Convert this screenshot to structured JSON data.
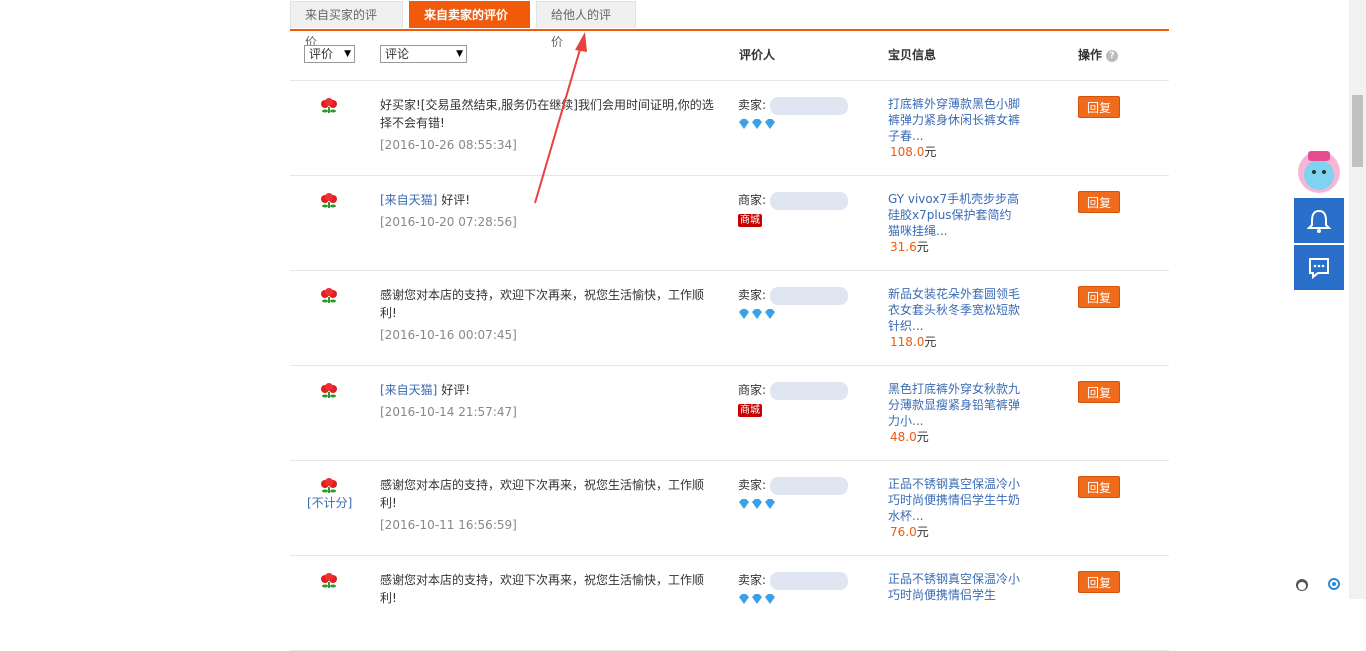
{
  "tabs": [
    {
      "label": "来自买家的评价"
    },
    {
      "label": "来自卖家的评价"
    },
    {
      "label": "给他人的评价"
    }
  ],
  "header": {
    "rating_select": "评价",
    "comment_select": "评论",
    "col_rater": "评价人",
    "col_item": "宝贝信息",
    "col_action": "操作",
    "help": "?"
  },
  "rows": [
    {
      "comment": "好买家![交易虽然结束,服务仍在继续]我们会用时间证明,你的选择不会有错!",
      "tag": "",
      "date": "[2016-10-26 08:55:34]",
      "rater_label": "卖家:",
      "item": "打底裤外穿薄款黑色小脚裤弹力紧身休闲长裤女裤子春...",
      "price": "108.0",
      "unit": "元",
      "reply": "回复"
    },
    {
      "comment": "好评!",
      "tag": "[来自天猫]",
      "date": "[2016-10-20 07:28:56]",
      "rater_label": "商家:",
      "item": "GY vivox7手机壳步步高硅胶x7plus保护套简约猫咪挂绳...",
      "price": "31.6",
      "unit": "元",
      "reply": "回复",
      "mall": "商城"
    },
    {
      "comment": "感谢您对本店的支持，欢迎下次再来，祝您生活愉快，工作顺利!",
      "tag": "",
      "date": "[2016-10-16 00:07:45]",
      "rater_label": "卖家:",
      "item": "新品女装花朵外套圆领毛衣女套头秋冬季宽松短款针织...",
      "price": "118.0",
      "unit": "元",
      "reply": "回复"
    },
    {
      "comment": "好评!",
      "tag": "[来自天猫]",
      "date": "[2016-10-14 21:57:47]",
      "rater_label": "商家:",
      "item": "黑色打底裤外穿女秋款九分薄款显瘦紧身铅笔裤弹力小...",
      "price": "48.0",
      "unit": "元",
      "reply": "回复",
      "mall": "商城"
    },
    {
      "comment": "感谢您对本店的支持，欢迎下次再来，祝您生活愉快，工作顺利!",
      "tag": "",
      "date": "[2016-10-11 16:56:59]",
      "rater_label": "卖家:",
      "item": "正品不锈钢真空保温冷小巧时尚便携情侣学生牛奶水杯...",
      "price": "76.0",
      "unit": "元",
      "reply": "回复",
      "nocount": "[不计分]"
    },
    {
      "comment": "感谢您对本店的支持，欢迎下次再来，祝您生活愉快，工作顺利!",
      "tag": "",
      "date": "",
      "rater_label": "卖家:",
      "item": "正品不锈钢真空保温冷小巧时尚便携情侣学生",
      "price": "",
      "unit": "",
      "reply": "回复"
    }
  ],
  "colors": {
    "accent": "#f05a0a",
    "link": "#3a6bb5",
    "side": "#2a6fc9"
  }
}
